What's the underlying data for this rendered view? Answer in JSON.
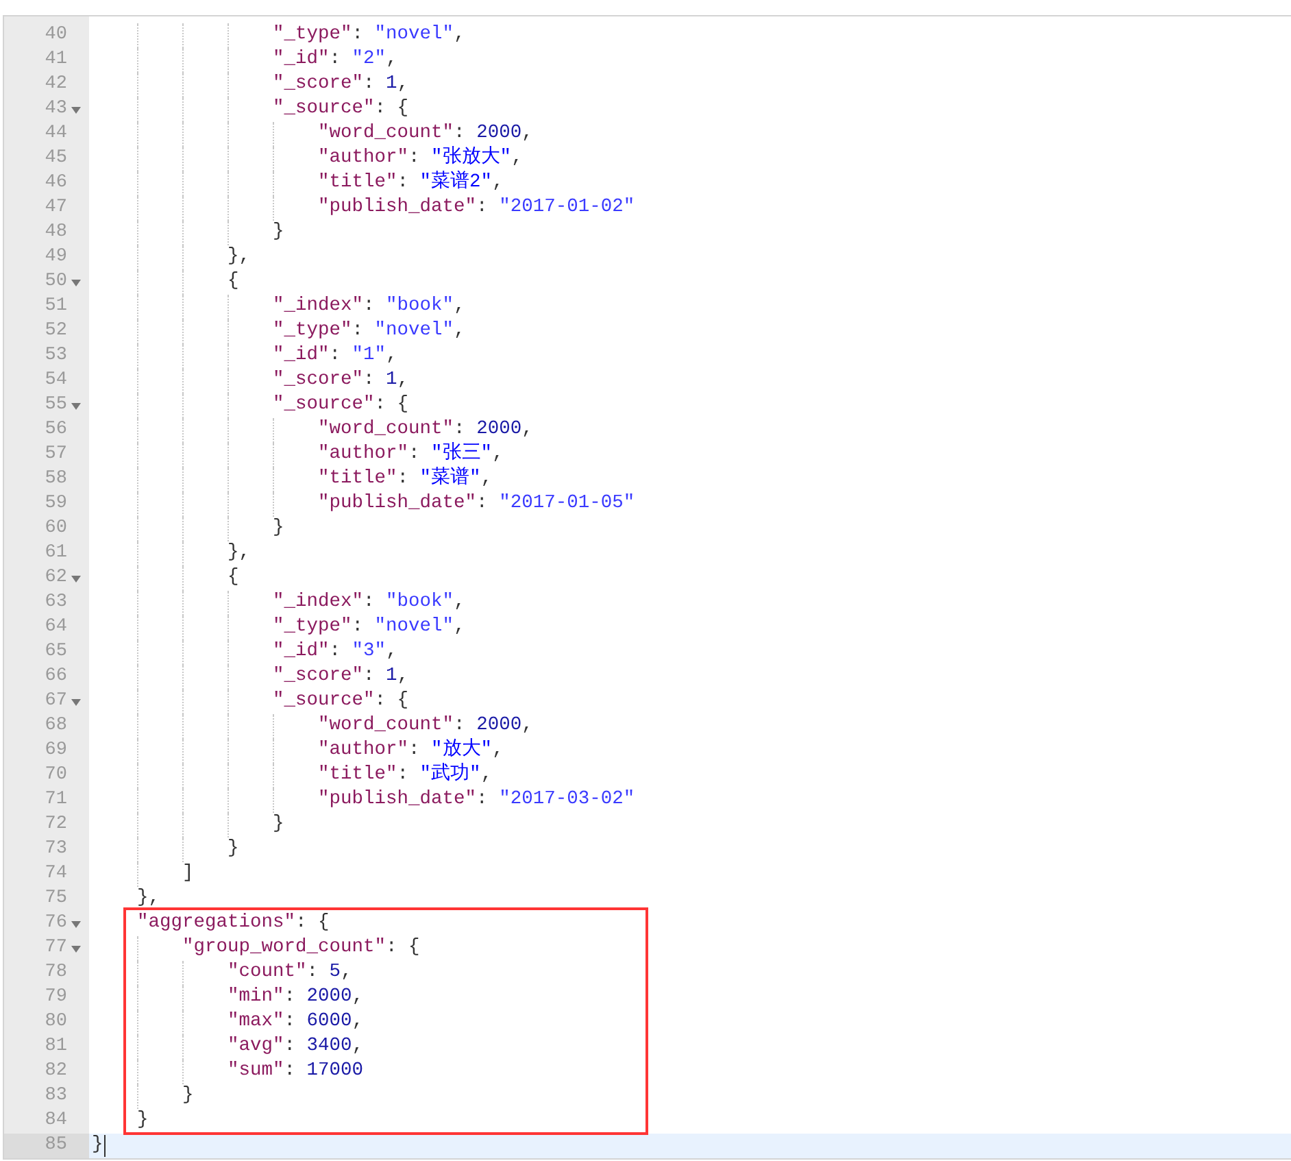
{
  "editor": {
    "lines": [
      {
        "kind": "group",
        "children": [
          {
            "kind": "group",
            "children": [
              {
                "kind": "group",
                "children": [
                  {
                    "kind": "group",
                    "children": [
                      {
                        "kind": "line",
                        "number": "40",
                        "text": "\"_type\": \"novel\","
                      },
                      {
                        "kind": "line",
                        "number": "41",
                        "text": "\"_id\": \"2\","
                      },
                      {
                        "kind": "line",
                        "number": "42",
                        "text": "\"_score\": 1,"
                      },
                      {
                        "kind": "line",
                        "number": "43",
                        "text": "\"_source\": {",
                        "expanded": true,
                        "children": [
                          {
                            "kind": "line",
                            "number": "44",
                            "text": "\"word_count\": 2000,"
                          },
                          {
                            "kind": "line",
                            "number": "45",
                            "text": "\"author\": \"张放大\","
                          },
                          {
                            "kind": "line",
                            "number": "46",
                            "text": "\"title\": \"菜谱2\","
                          },
                          {
                            "kind": "line",
                            "number": "47",
                            "text": "\"publish_date\": \"2017-01-02\""
                          }
                        ]
                      },
                      {
                        "kind": "line",
                        "number": "48",
                        "text": "}"
                      }
                    ]
                  },
                  {
                    "kind": "line",
                    "number": "49",
                    "text": "},"
                  },
                  {
                    "kind": "line",
                    "number": "50",
                    "text": "{",
                    "expanded": true,
                    "children": [
                      {
                        "kind": "line",
                        "number": "51",
                        "text": "\"_index\": \"book\","
                      },
                      {
                        "kind": "line",
                        "number": "52",
                        "text": "\"_type\": \"novel\","
                      },
                      {
                        "kind": "line",
                        "number": "53",
                        "text": "\"_id\": \"1\","
                      },
                      {
                        "kind": "line",
                        "number": "54",
                        "text": "\"_score\": 1,"
                      },
                      {
                        "kind": "line",
                        "number": "55",
                        "text": "\"_source\": {",
                        "expanded": true,
                        "children": [
                          {
                            "kind": "line",
                            "number": "56",
                            "text": "\"word_count\": 2000,"
                          },
                          {
                            "kind": "line",
                            "number": "57",
                            "text": "\"author\": \"张三\","
                          },
                          {
                            "kind": "line",
                            "number": "58",
                            "text": "\"title\": \"菜谱\","
                          },
                          {
                            "kind": "line",
                            "number": "59",
                            "text": "\"publish_date\": \"2017-01-05\""
                          }
                        ]
                      },
                      {
                        "kind": "line",
                        "number": "60",
                        "text": "}"
                      }
                    ]
                  },
                  {
                    "kind": "line",
                    "number": "61",
                    "text": "},"
                  },
                  {
                    "kind": "line",
                    "number": "62",
                    "text": "{",
                    "expanded": true,
                    "children": [
                      {
                        "kind": "line",
                        "number": "63",
                        "text": "\"_index\": \"book\","
                      },
                      {
                        "kind": "line",
                        "number": "64",
                        "text": "\"_type\": \"novel\","
                      },
                      {
                        "kind": "line",
                        "number": "65",
                        "text": "\"_id\": \"3\","
                      },
                      {
                        "kind": "line",
                        "number": "66",
                        "text": "\"_score\": 1,"
                      },
                      {
                        "kind": "line",
                        "number": "67",
                        "text": "\"_source\": {",
                        "expanded": true,
                        "children": [
                          {
                            "kind": "line",
                            "number": "68",
                            "text": "\"word_count\": 2000,"
                          },
                          {
                            "kind": "line",
                            "number": "69",
                            "text": "\"author\": \"放大\","
                          },
                          {
                            "kind": "line",
                            "number": "70",
                            "text": "\"title\": \"武功\","
                          },
                          {
                            "kind": "line",
                            "number": "71",
                            "text": "\"publish_date\": \"2017-03-02\""
                          }
                        ]
                      },
                      {
                        "kind": "line",
                        "number": "72",
                        "text": "}"
                      }
                    ]
                  },
                  {
                    "kind": "line",
                    "number": "73",
                    "text": "}"
                  }
                ]
              },
              {
                "kind": "line",
                "number": "74",
                "text": "]"
              }
            ]
          },
          {
            "kind": "line",
            "number": "75",
            "text": "},"
          },
          {
            "kind": "highlight",
            "children": [
              {
                "kind": "line",
                "number": "76",
                "text": "\"aggregations\": {",
                "expanded": true,
                "children": [
                  {
                    "kind": "line",
                    "number": "77",
                    "text": "\"group_word_count\": {",
                    "expanded": true,
                    "children": [
                      {
                        "kind": "line",
                        "number": "78",
                        "text": "\"count\": 5,"
                      },
                      {
                        "kind": "line",
                        "number": "79",
                        "text": "\"min\": 2000,"
                      },
                      {
                        "kind": "line",
                        "number": "80",
                        "text": "\"max\": 6000,"
                      },
                      {
                        "kind": "line",
                        "number": "81",
                        "text": "\"avg\": 3400,"
                      },
                      {
                        "kind": "line",
                        "number": "82",
                        "text": "\"sum\": 17000"
                      }
                    ]
                  },
                  {
                    "kind": "line",
                    "number": "83",
                    "text": "}"
                  }
                ]
              },
              {
                "kind": "line",
                "number": "84",
                "text": "}"
              }
            ]
          }
        ]
      },
      {
        "kind": "cursor-line",
        "number": "85",
        "text": "}"
      }
    ]
  }
}
